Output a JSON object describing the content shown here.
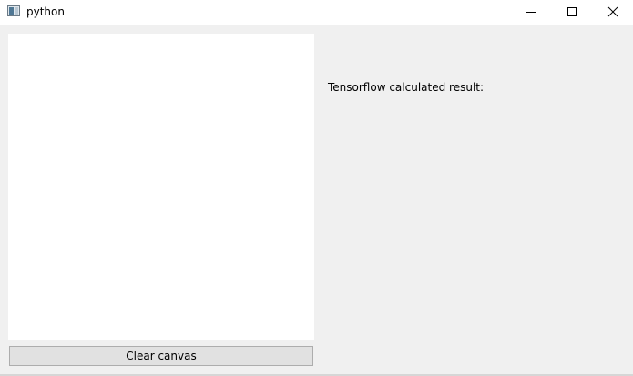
{
  "window": {
    "title": "python",
    "icon": "app-window-icon",
    "controls": {
      "minimize": "minimize-icon",
      "maximize": "maximize-icon",
      "close": "close-icon"
    }
  },
  "canvas": {
    "background": "#ffffff"
  },
  "buttons": {
    "clear_label": "Clear canvas"
  },
  "result": {
    "label": "Tensorflow calculated result:"
  },
  "colors": {
    "window_bg": "#f0f0f0",
    "titlebar_bg": "#ffffff",
    "button_bg": "#e1e1e1",
    "button_border": "#adadad"
  }
}
